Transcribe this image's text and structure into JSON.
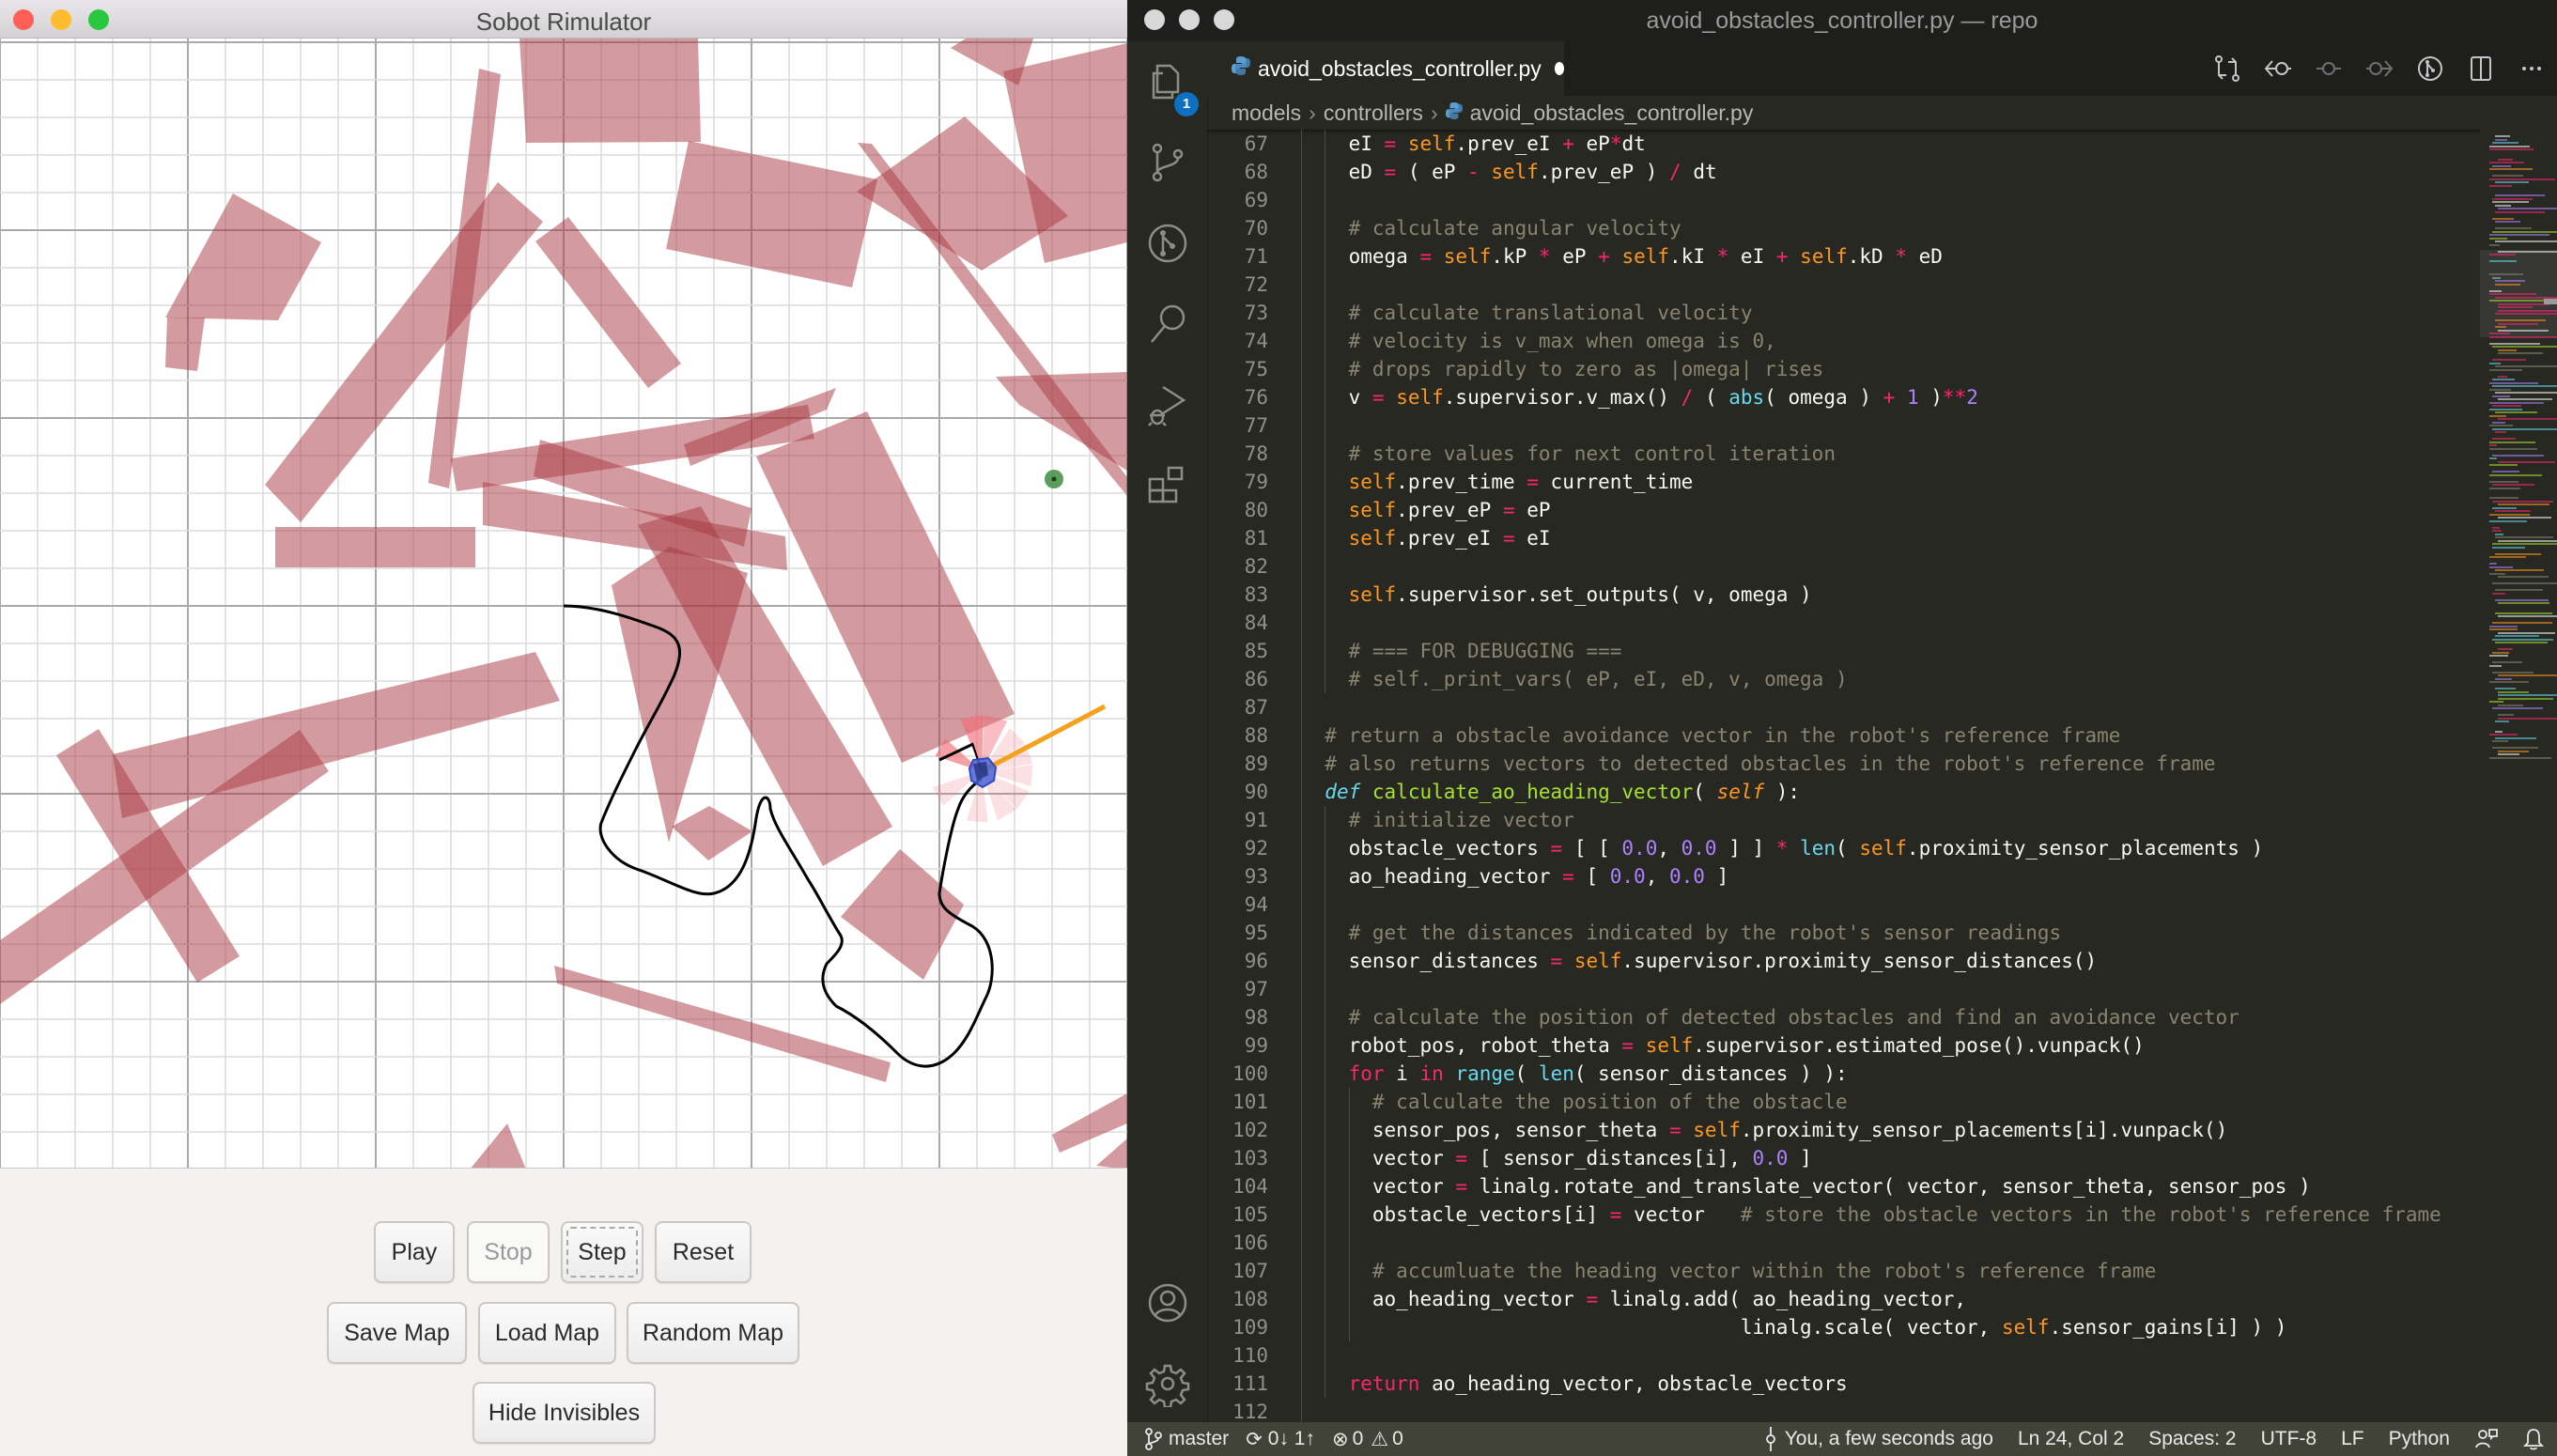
{
  "simulator": {
    "window_title": "Sobot Rimulator",
    "traffic_lights": {
      "close": "#ff5f57",
      "minimize": "#febc2e",
      "zoom": "#28c840"
    },
    "colors": {
      "obstacle": "#a8373f",
      "goal": "#3d8c40",
      "robot": "#4a63d6",
      "heading": "#f5a11c",
      "path": "#000000",
      "sensor": "#f06b78"
    },
    "buttons": {
      "play": "Play",
      "stop": "Stop",
      "step": "Step",
      "reset": "Reset",
      "save_map": "Save Map",
      "load_map": "Load Map",
      "random_map": "Random Map",
      "hide_invisibles": "Hide Invisibles"
    },
    "button_states": {
      "stop": "disabled",
      "step": "focused"
    }
  },
  "vscode": {
    "window_title": "avoid_obstacles_controller.py — repo",
    "activity_bar": {
      "items": [
        "explorer-icon",
        "source-control-icon",
        "git-graph-icon",
        "search-icon",
        "run-debug-icon",
        "extensions-icon"
      ],
      "explorer_badge": "1",
      "bottom_items": [
        "account-icon",
        "settings-gear-icon"
      ]
    },
    "tab": {
      "label": "avoid_obstacles_controller.py",
      "modified": true
    },
    "toolbar": [
      "open-changes-icon",
      "go-back-icon",
      "timeline-dot-icon",
      "go-forward-icon",
      "git-graph-icon",
      "split-editor-icon",
      "more-actions-icon"
    ],
    "breadcrumb": [
      "models",
      "controllers",
      "avoid_obstacles_controller.py"
    ],
    "code_lines": [
      {
        "n": "67",
        "indent": 2,
        "html": "eI <k>=</k> <s>self</s>.prev_eI <k>+</k> eP<k>*</k>dt"
      },
      {
        "n": "68",
        "indent": 2,
        "html": "eD <k>=</k> ( eP <k>-</k> <s>self</s>.prev_eP ) <k>/</k> dt"
      },
      {
        "n": "69",
        "indent": 2,
        "html": ""
      },
      {
        "n": "70",
        "indent": 2,
        "html": "<c># calculate angular velocity</c>"
      },
      {
        "n": "71",
        "indent": 2,
        "html": "omega <k>=</k> <s>self</s>.kP <k>*</k> eP <k>+</k> <s>self</s>.kI <k>*</k> eI <k>+</k> <s>self</s>.kD <k>*</k> eD"
      },
      {
        "n": "72",
        "indent": 2,
        "html": ""
      },
      {
        "n": "73",
        "indent": 2,
        "html": "<c># calculate translational velocity</c>"
      },
      {
        "n": "74",
        "indent": 2,
        "html": "<c># velocity is v_max when omega is 0,</c>"
      },
      {
        "n": "75",
        "indent": 2,
        "html": "<c># drops rapidly to zero as |omega| rises</c>"
      },
      {
        "n": "76",
        "indent": 2,
        "html": "v <k>=</k> <s>self</s>.supervisor.v_max() <k>/</k> ( <b>abs</b>( omega ) <k>+</k> <n>1</n> )<k>**</k><n>2</n>"
      },
      {
        "n": "77",
        "indent": 2,
        "html": ""
      },
      {
        "n": "78",
        "indent": 2,
        "html": "<c># store values for next control iteration</c>"
      },
      {
        "n": "79",
        "indent": 2,
        "html": "<s>self</s>.prev_time <k>=</k> current_time"
      },
      {
        "n": "80",
        "indent": 2,
        "html": "<s>self</s>.prev_eP <k>=</k> eP"
      },
      {
        "n": "81",
        "indent": 2,
        "html": "<s>self</s>.prev_eI <k>=</k> eI"
      },
      {
        "n": "82",
        "indent": 2,
        "html": ""
      },
      {
        "n": "83",
        "indent": 2,
        "html": "<s>self</s>.supervisor.set_outputs( v, omega )"
      },
      {
        "n": "84",
        "indent": 2,
        "html": ""
      },
      {
        "n": "85",
        "indent": 2,
        "html": "<c># === FOR DEBUGGING ===</c>"
      },
      {
        "n": "86",
        "indent": 2,
        "html": "<c># self._print_vars( eP, eI, eD, v, omega )</c>"
      },
      {
        "n": "87",
        "indent": 1,
        "html": ""
      },
      {
        "n": "88",
        "indent": 1,
        "html": "<c># return a obstacle avoidance vector in the robot's reference frame</c>"
      },
      {
        "n": "89",
        "indent": 1,
        "html": "<c># also returns vectors to detected obstacles in the robot's reference frame</c>"
      },
      {
        "n": "90",
        "indent": 1,
        "html": "<d>def</d> <f>calculate_ao_heading_vector</f>( <p>self</p> ):"
      },
      {
        "n": "91",
        "indent": 2,
        "html": "<c># initialize vector</c>"
      },
      {
        "n": "92",
        "indent": 2,
        "html": "obstacle_vectors <k>=</k> [ [ <n>0.0</n>, <n>0.0</n> ] ] <k>*</k> <b>len</b>( <s>self</s>.proximity_sensor_placements )"
      },
      {
        "n": "93",
        "indent": 2,
        "html": "ao_heading_vector <k>=</k> [ <n>0.0</n>, <n>0.0</n> ]"
      },
      {
        "n": "94",
        "indent": 2,
        "html": ""
      },
      {
        "n": "95",
        "indent": 2,
        "html": "<c># get the distances indicated by the robot's sensor readings</c>"
      },
      {
        "n": "96",
        "indent": 2,
        "html": "sensor_distances <k>=</k> <s>self</s>.supervisor.proximity_sensor_distances()"
      },
      {
        "n": "97",
        "indent": 2,
        "html": ""
      },
      {
        "n": "98",
        "indent": 2,
        "html": "<c># calculate the position of detected obstacles and find an avoidance vector</c>"
      },
      {
        "n": "99",
        "indent": 2,
        "html": "robot_pos, robot_theta <k>=</k> <s>self</s>.supervisor.estimated_pose().vunpack()"
      },
      {
        "n": "100",
        "indent": 2,
        "html": "<k>for</k> i <k>in</k> <b>range</b>( <b>len</b>( sensor_distances ) ):"
      },
      {
        "n": "101",
        "indent": 3,
        "html": "<c># calculate the position of the obstacle</c>"
      },
      {
        "n": "102",
        "indent": 3,
        "html": "sensor_pos, sensor_theta <k>=</k> <s>self</s>.proximity_sensor_placements[i].vunpack()"
      },
      {
        "n": "103",
        "indent": 3,
        "html": "vector <k>=</k> [ sensor_distances[i], <n>0.0</n> ]"
      },
      {
        "n": "104",
        "indent": 3,
        "html": "vector <k>=</k> linalg.rotate_and_translate_vector( vector, sensor_theta, sensor_pos )"
      },
      {
        "n": "105",
        "indent": 3,
        "html": "obstacle_vectors[i] <k>=</k> vector   <c># store the obstacle vectors in the robot's reference frame</c>"
      },
      {
        "n": "106",
        "indent": 3,
        "html": ""
      },
      {
        "n": "107",
        "indent": 3,
        "html": "<c># accumluate the heading vector within the robot's reference frame</c>"
      },
      {
        "n": "108",
        "indent": 3,
        "html": "ao_heading_vector <k>=</k> linalg.add( ao_heading_vector,"
      },
      {
        "n": "109",
        "indent": 3,
        "html": "                               linalg.scale( vector, <s>self</s>.sensor_gains[i] ) )"
      },
      {
        "n": "110",
        "indent": 2,
        "html": ""
      },
      {
        "n": "111",
        "indent": 2,
        "html": "<k>return</k> ao_heading_vector, obstacle_vectors"
      },
      {
        "n": "112",
        "indent": 1,
        "html": ""
      }
    ],
    "status_bar": {
      "branch": "master",
      "sync": "0↓ 1↑",
      "errors": "0",
      "warnings": "0",
      "blame": "You, a few seconds ago",
      "cursor": "Ln 24, Col 2",
      "spaces": "Spaces: 2",
      "encoding": "UTF-8",
      "eol": "LF",
      "language": "Python"
    },
    "colors": {
      "editor_bg": "#272822",
      "status_bg": "#414339",
      "badge": "#0e70c0"
    }
  }
}
